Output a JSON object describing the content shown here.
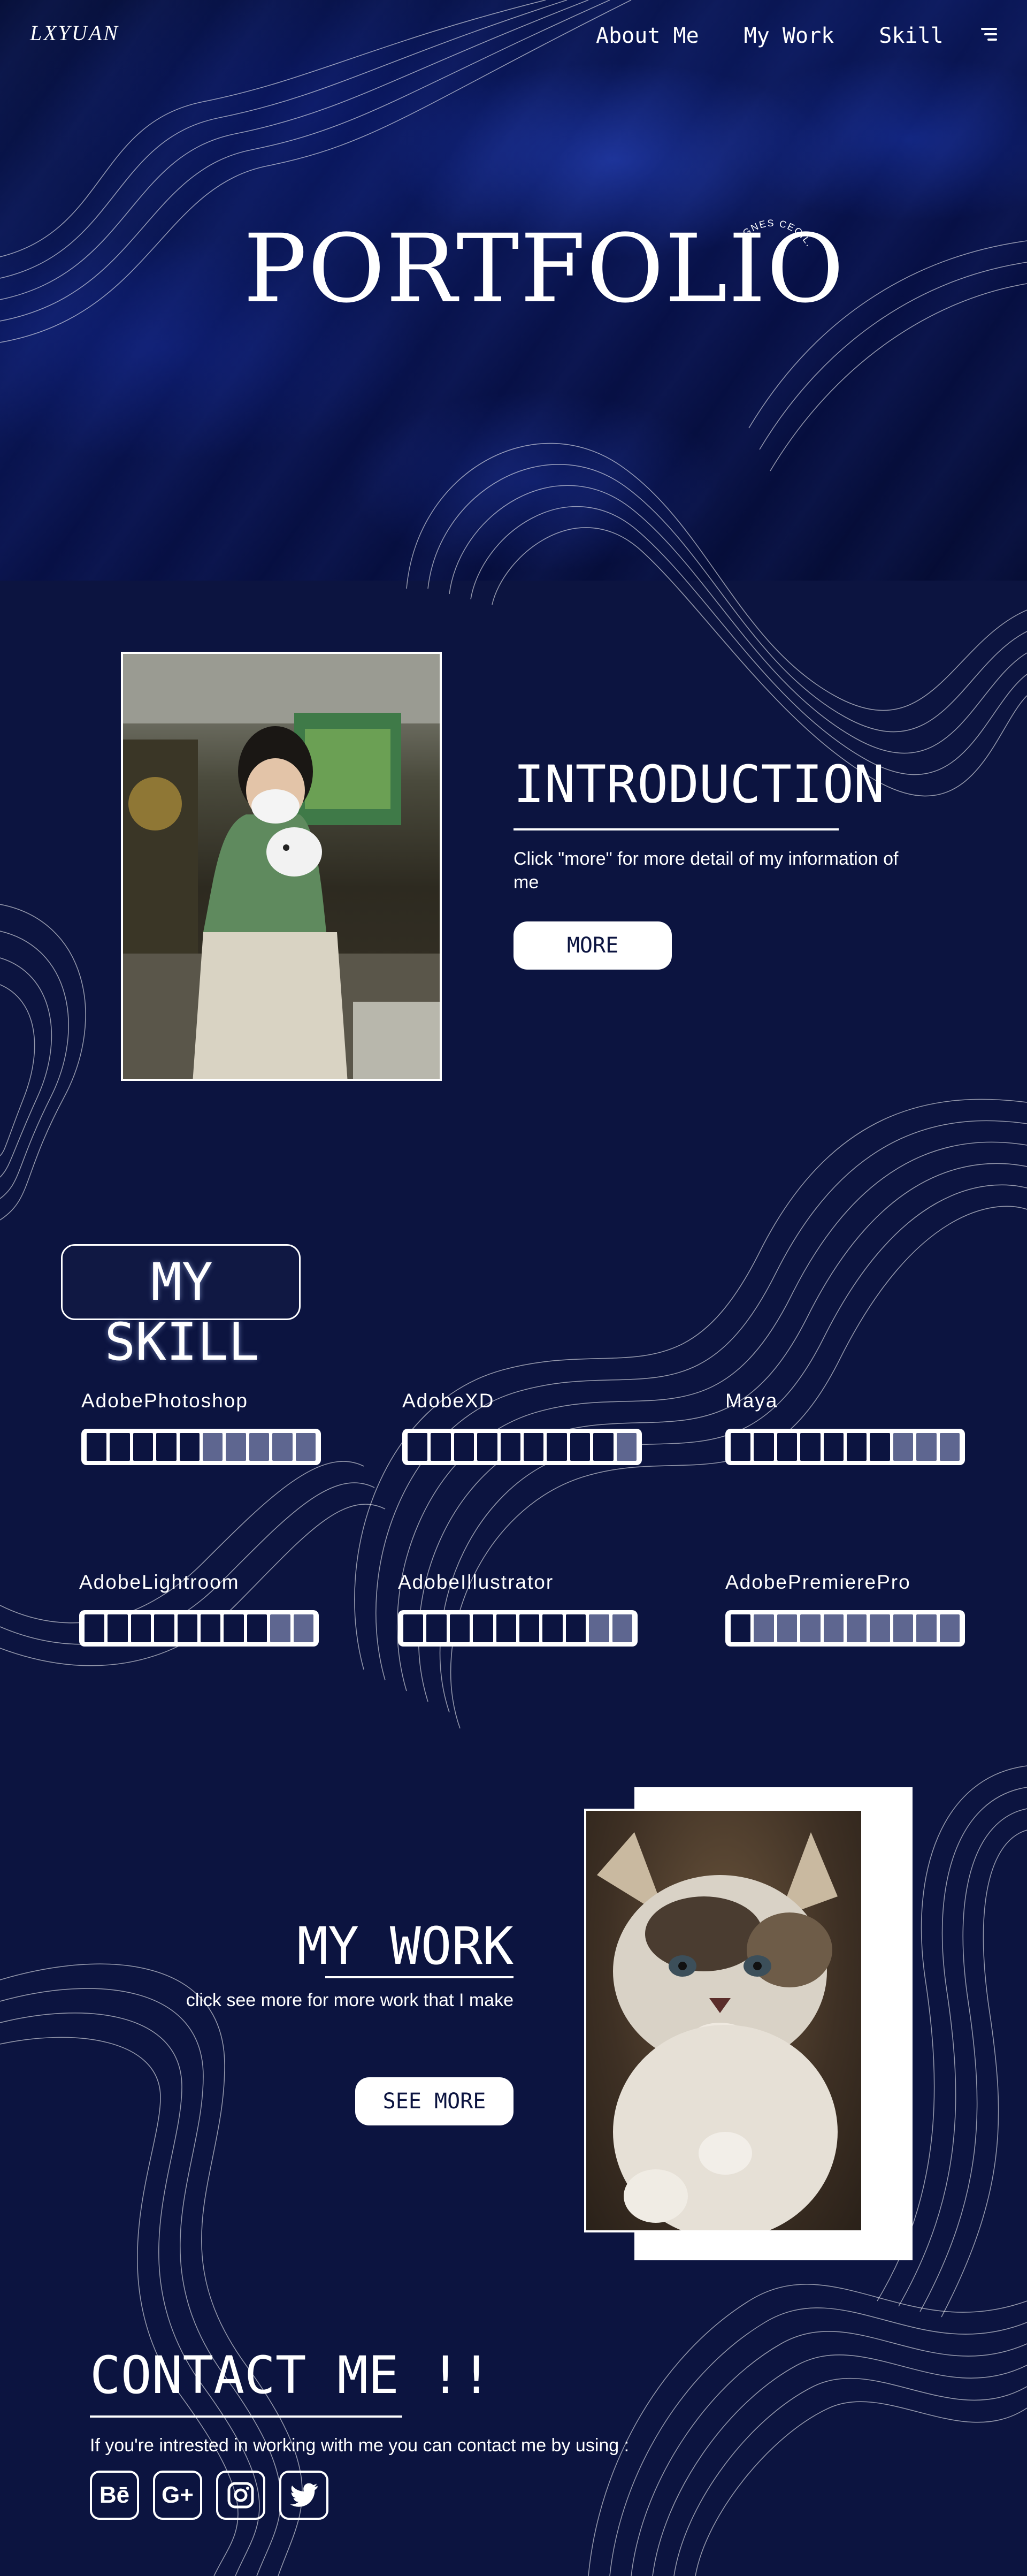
{
  "header": {
    "logo": "LXYUAN",
    "nav": [
      "About Me",
      "My Work",
      "Skill"
    ]
  },
  "hero": {
    "title": "PORTFOLIO",
    "subtitle": "IGNES CECILIA"
  },
  "intro": {
    "title": "INTRODUCTION",
    "text": "Click \"more\" for more detail of my information of me",
    "button": "MORE"
  },
  "skills": {
    "title": "MY SKILL",
    "items": [
      {
        "name": "AdobePhotoshop",
        "level": 5,
        "total": 10
      },
      {
        "name": "AdobeXD",
        "level": 9,
        "total": 10
      },
      {
        "name": "Maya",
        "level": 7,
        "total": 10
      },
      {
        "name": "AdobeLightroom",
        "level": 8,
        "total": 10
      },
      {
        "name": "AdobeIllustrator",
        "level": 8,
        "total": 10
      },
      {
        "name": "AdobePremierePro",
        "level": 1,
        "total": 10
      }
    ]
  },
  "work": {
    "title": "MY WORK",
    "text": "click see more for more work that I make",
    "button": "SEE MORE"
  },
  "contact": {
    "title": "CONTACT ME !!",
    "text": "If you're intrested in working with me you can contact me by using :",
    "socials": [
      {
        "label": "Bē",
        "icon": "behance-icon"
      },
      {
        "label": "G+",
        "icon": "google-plus-icon"
      },
      {
        "label": "",
        "icon": "instagram-icon"
      },
      {
        "label": "",
        "icon": "twitter-icon"
      }
    ]
  },
  "colors": {
    "background": "#0c1440",
    "accent": "#ffffff",
    "bar_empty": "#5e6690"
  }
}
